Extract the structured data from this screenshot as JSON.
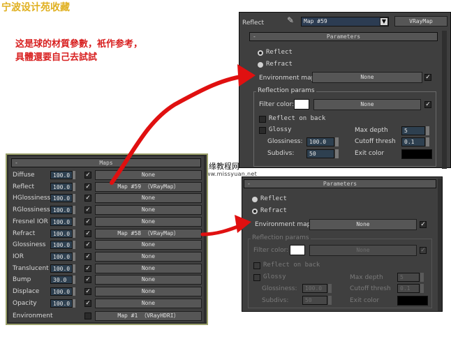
{
  "watermark": "宁波设计苑收藏",
  "note": {
    "line1": "这是球的材質參數，衹作参考，",
    "line2": "具體還要自己去試試"
  },
  "site": {
    "name": "思缘教程网",
    "url": "www.missyuan.net"
  },
  "maps_panel": {
    "title": "Maps",
    "rows": [
      {
        "label": "Diffuse",
        "value": "100.0",
        "map": "None"
      },
      {
        "label": "Reflect",
        "value": "100.0",
        "map": "Map #59 （VRayMap）"
      },
      {
        "label": "HGlossiness",
        "value": "100.0",
        "map": "None"
      },
      {
        "label": "RGlossiness",
        "value": "100.0",
        "map": "None"
      },
      {
        "label": "Fresnel IOR",
        "value": "100.0",
        "map": "None"
      },
      {
        "label": "Refract",
        "value": "100.0",
        "map": "Map #58 （VRayMap）"
      },
      {
        "label": "Glossiness",
        "value": "100.0",
        "map": "None"
      },
      {
        "label": "IOR",
        "value": "100.0",
        "map": "None"
      },
      {
        "label": "Translucent",
        "value": "100.0",
        "map": "None"
      },
      {
        "label": "Bump",
        "value": "30.0",
        "map": "None"
      },
      {
        "label": "Displace",
        "value": "100.0",
        "map": "None"
      },
      {
        "label": "Opacity",
        "value": "100.0",
        "map": "None"
      }
    ],
    "environment": {
      "label": "Environment",
      "map": "Map #1 （VRayHDRI）"
    }
  },
  "reflect_panel": {
    "header_label": "Reflect",
    "map_name": "Map #59",
    "map_type": "VRayMap",
    "params_title": "Parameters",
    "radio_reflect": "Reflect",
    "radio_refract": "Refract",
    "env_label": "Environment map:",
    "env_value": "None",
    "group_title": "Reflection params",
    "filter_label": "Filter color:",
    "filter_map": "None",
    "reflect_on_back": "Reflect on back",
    "glossy": "Glossy",
    "glossiness_label": "Glossiness:",
    "glossiness": "100.0",
    "subdivs_label": "Subdivs:",
    "subdivs": "50",
    "max_depth_label": "Max depth",
    "max_depth": "5",
    "cutoff_label": "Cutoff thresh",
    "cutoff": "0.1",
    "exit_label": "Exit color"
  },
  "refract_panel": {
    "params_title": "Parameters",
    "radio_reflect": "Reflect",
    "radio_refract": "Refract",
    "env_label": "Environment map:",
    "env_value": "None",
    "group_title": "Reflection params",
    "filter_label": "Filter color:",
    "filter_map": "None",
    "reflect_on_back": "Reflect on back",
    "glossy": "Glossy",
    "glossiness_label": "Glossiness:",
    "glossiness": "100.0",
    "subdivs_label": "Subdivs:",
    "subdivs": "50",
    "max_depth_label": "Max depth",
    "max_depth": "5",
    "cutoff_label": "Cutoff thresh",
    "cutoff": "0.1",
    "exit_label": "Exit color"
  },
  "colors": {
    "arrow": "#e01010",
    "panel": "#3f3f3f",
    "field": "#2e4050"
  }
}
